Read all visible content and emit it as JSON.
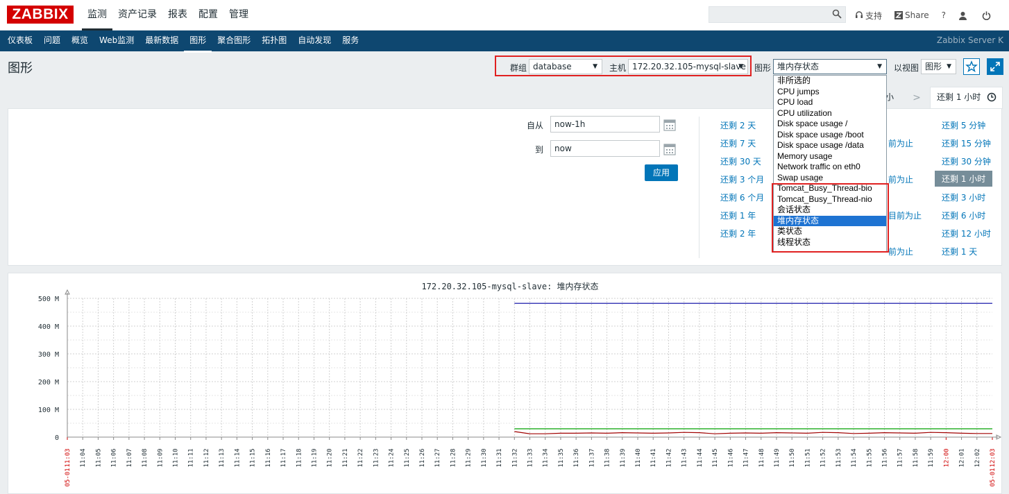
{
  "header": {
    "logo": "ZABBIX",
    "menu": [
      "监测",
      "资产记录",
      "报表",
      "配置",
      "管理"
    ],
    "search_placeholder": "",
    "links": {
      "support": "支持",
      "share": "Share",
      "help": "?"
    }
  },
  "subnav": {
    "items": [
      "仪表板",
      "问题",
      "概览",
      "Web监测",
      "最新数据",
      "图形",
      "聚合图形",
      "拓扑图",
      "自动发现",
      "服务"
    ],
    "server": "Zabbix Server K"
  },
  "page": {
    "title": "图形",
    "group_label": "群组",
    "group_value": "database",
    "host_label": "主机",
    "host_value": "172.20.32.105-mysql-slave",
    "graph_label": "图形",
    "graph_value": "堆内存状态",
    "view_label": "以视图",
    "view_value": "图形"
  },
  "dropdown": {
    "options": [
      "非所选的",
      "CPU jumps",
      "CPU load",
      "CPU utilization",
      "Disk space usage /",
      "Disk space usage /boot",
      "Disk space usage /data",
      "Memory usage",
      "Network traffic on eth0",
      "Swap usage",
      "Tomcat_Busy_Thread-bio",
      "Tomcat_Busy_Thread-nio",
      "会话状态",
      "堆内存状态",
      "类状态",
      "线程状态"
    ],
    "selected": "堆内存状态"
  },
  "tabs": {
    "left_partial": "小",
    "active": "还剩 1 小时"
  },
  "timefilter": {
    "from_label": "自从",
    "from_value": "now-1h",
    "to_label": "到",
    "to_value": "now",
    "apply": "应用"
  },
  "quick": {
    "col1": [
      "还剩 2 天",
      "还剩 7 天",
      "还剩 30 天",
      "还剩 3 个月",
      "还剩 6 个月",
      "还剩 1 年",
      "还剩 2 年"
    ],
    "col3": [
      "前为止",
      "前为止",
      "目前为止",
      "前为止"
    ],
    "col4": [
      "还剩 5 分钟",
      "还剩 15 分钟",
      "还剩 30 分钟",
      "还剩 1 小时",
      "还剩 3 小时",
      "还剩 6 小时",
      "还剩 12 小时",
      "还剩 1 天"
    ]
  },
  "graph": {
    "title": "172.20.32.105-mysql-slave: 堆内存状态"
  },
  "chart_data": {
    "type": "line",
    "title": "172.20.32.105-mysql-slave: 堆内存状态",
    "y_ticks": [
      "0",
      "100 M",
      "200 M",
      "300 M",
      "400 M",
      "500 M"
    ],
    "ylim": [
      0,
      500
    ],
    "x_ticks": [
      "11:03",
      "11:04",
      "11:05",
      "11:06",
      "11:07",
      "11:08",
      "11:09",
      "11:10",
      "11:11",
      "11:12",
      "11:13",
      "11:14",
      "11:15",
      "11:16",
      "11:17",
      "11:18",
      "11:19",
      "11:20",
      "11:21",
      "11:22",
      "11:23",
      "11:24",
      "11:25",
      "11:26",
      "11:27",
      "11:28",
      "11:29",
      "11:30",
      "11:31",
      "11:32",
      "11:33",
      "11:34",
      "11:35",
      "11:36",
      "11:37",
      "11:38",
      "11:39",
      "11:40",
      "11:41",
      "11:42",
      "11:43",
      "11:44",
      "11:45",
      "11:46",
      "11:47",
      "11:48",
      "11:49",
      "11:50",
      "11:51",
      "11:52",
      "11:53",
      "11:54",
      "11:55",
      "11:56",
      "11:57",
      "11:58",
      "11:59",
      "12:00",
      "12:01",
      "12:02",
      "12:03"
    ],
    "date_label": "05-01",
    "highlight_ticks": [
      "11:03",
      "12:00",
      "12:03"
    ],
    "series": [
      {
        "color": "#0000a0",
        "x_start": "11:32",
        "x_end": "12:03",
        "values": [
          482,
          482
        ]
      },
      {
        "color": "#00a000",
        "x_start": "11:32",
        "x_end": "12:03",
        "values": [
          30,
          30
        ]
      },
      {
        "color": "#a00000",
        "x_start": "11:32",
        "x_end": "12:03",
        "values": [
          20,
          12,
          12,
          14,
          14,
          15,
          14,
          16,
          15,
          14,
          15,
          17,
          16,
          12,
          14,
          15,
          14,
          16,
          15,
          14,
          17,
          16,
          13,
          14,
          16,
          15,
          14,
          17,
          16,
          14,
          13,
          13
        ]
      }
    ]
  }
}
